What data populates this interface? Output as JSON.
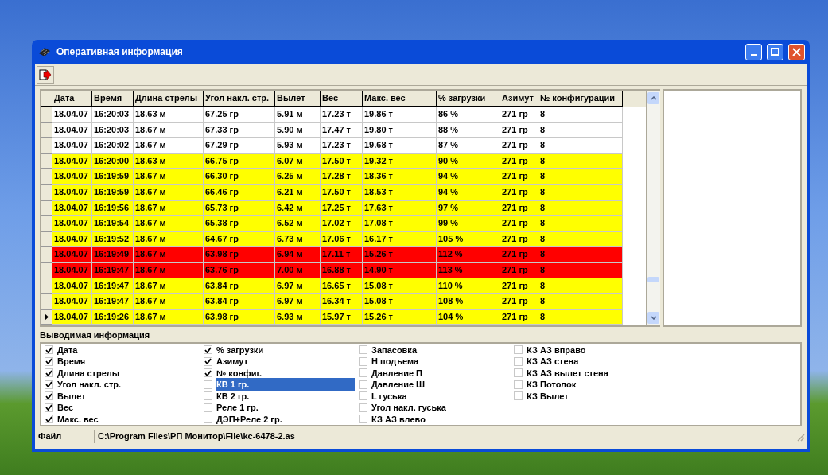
{
  "window": {
    "title": "Оперативная информация"
  },
  "table": {
    "columns": [
      "Дата",
      "Время",
      "Длина стрелы",
      "Угол накл. стр.",
      "Вылет",
      "Вес",
      "Макс. вес",
      "% загрузки",
      "Азимут",
      "№ конфигурации"
    ],
    "rows": [
      {
        "color": "#ffffff",
        "selected": false,
        "cells": [
          "18.04.07",
          "16:20:03",
          "18.63 м",
          "67.25 гр",
          "5.91 м",
          "17.23 т",
          "19.86 т",
          "86 %",
          "271 гр",
          "8"
        ]
      },
      {
        "color": "#ffffff",
        "selected": false,
        "cells": [
          "18.04.07",
          "16:20:03",
          "18.67 м",
          "67.33 гр",
          "5.90 м",
          "17.47 т",
          "19.80 т",
          "88 %",
          "271 гр",
          "8"
        ]
      },
      {
        "color": "#ffffff",
        "selected": false,
        "cells": [
          "18.04.07",
          "16:20:02",
          "18.67 м",
          "67.29 гр",
          "5.93 м",
          "17.23 т",
          "19.68 т",
          "87 %",
          "271 гр",
          "8"
        ]
      },
      {
        "color": "#ffff00",
        "selected": false,
        "cells": [
          "18.04.07",
          "16:20:00",
          "18.63 м",
          "66.75 гр",
          "6.07 м",
          "17.50 т",
          "19.32 т",
          "90 %",
          "271 гр",
          "8"
        ]
      },
      {
        "color": "#ffff00",
        "selected": false,
        "cells": [
          "18.04.07",
          "16:19:59",
          "18.67 м",
          "66.30 гр",
          "6.25 м",
          "17.28 т",
          "18.36 т",
          "94 %",
          "271 гр",
          "8"
        ]
      },
      {
        "color": "#ffff00",
        "selected": false,
        "cells": [
          "18.04.07",
          "16:19:59",
          "18.67 м",
          "66.46 гр",
          "6.21 м",
          "17.50 т",
          "18.53 т",
          "94 %",
          "271 гр",
          "8"
        ]
      },
      {
        "color": "#ffff00",
        "selected": false,
        "cells": [
          "18.04.07",
          "16:19:56",
          "18.67 м",
          "65.73 гр",
          "6.42 м",
          "17.25 т",
          "17.63 т",
          "97 %",
          "271 гр",
          "8"
        ]
      },
      {
        "color": "#ffff00",
        "selected": false,
        "cells": [
          "18.04.07",
          "16:19:54",
          "18.67 м",
          "65.38 гр",
          "6.52 м",
          "17.02 т",
          "17.08 т",
          "99 %",
          "271 гр",
          "8"
        ]
      },
      {
        "color": "#ffff00",
        "selected": false,
        "cells": [
          "18.04.07",
          "16:19:52",
          "18.67 м",
          "64.67 гр",
          "6.73 м",
          "17.06 т",
          "16.17 т",
          "105 %",
          "271 гр",
          "8"
        ]
      },
      {
        "color": "#ff0000",
        "selected": false,
        "cells": [
          "18.04.07",
          "16:19:49",
          "18.67 м",
          "63.98 гр",
          "6.94 м",
          "17.11 т",
          "15.26 т",
          "112 %",
          "271 гр",
          "8"
        ]
      },
      {
        "color": "#ff0000",
        "selected": false,
        "cells": [
          "18.04.07",
          "16:19:47",
          "18.67 м",
          "63.76 гр",
          "7.00 м",
          "16.88 т",
          "14.90 т",
          "113 %",
          "271 гр",
          "8"
        ]
      },
      {
        "color": "#ffff00",
        "selected": false,
        "cells": [
          "18.04.07",
          "16:19:47",
          "18.67 м",
          "63.84 гр",
          "6.97 м",
          "16.65 т",
          "15.08 т",
          "110 %",
          "271 гр",
          "8"
        ]
      },
      {
        "color": "#ffff00",
        "selected": false,
        "cells": [
          "18.04.07",
          "16:19:47",
          "18.67 м",
          "63.84 гр",
          "6.97 м",
          "16.34 т",
          "15.08 т",
          "108 %",
          "271 гр",
          "8"
        ]
      },
      {
        "color": "#ffff00",
        "selected": true,
        "cells": [
          "18.04.07",
          "16:19:26",
          "18.67 м",
          "63.98 гр",
          "6.93 м",
          "15.97 т",
          "15.26 т",
          "104 %",
          "271 гр",
          "8"
        ]
      }
    ]
  },
  "output_info": {
    "title": "Выводимая информация",
    "columns": [
      [
        {
          "label": "Дата",
          "checked": true,
          "selected": false
        },
        {
          "label": "Время",
          "checked": true,
          "selected": false
        },
        {
          "label": "Длина стрелы",
          "checked": true,
          "selected": false
        },
        {
          "label": "Угол накл. стр.",
          "checked": true,
          "selected": false
        },
        {
          "label": "Вылет",
          "checked": true,
          "selected": false
        },
        {
          "label": "Вес",
          "checked": true,
          "selected": false
        },
        {
          "label": "Макс. вес",
          "checked": true,
          "selected": false
        }
      ],
      [
        {
          "label": "% загрузки",
          "checked": true,
          "selected": false
        },
        {
          "label": "Азимут",
          "checked": true,
          "selected": false
        },
        {
          "label": "№ конфиг.",
          "checked": true,
          "selected": false
        },
        {
          "label": "КВ 1 гр.",
          "checked": false,
          "selected": true
        },
        {
          "label": "КВ 2 гр.",
          "checked": false,
          "selected": false
        },
        {
          "label": "Реле 1 гр.",
          "checked": false,
          "selected": false
        },
        {
          "label": "ДЭП+Реле 2 гр.",
          "checked": false,
          "selected": false
        }
      ],
      [
        {
          "label": "Запасовка",
          "checked": false,
          "selected": false
        },
        {
          "label": "Н подъема",
          "checked": false,
          "selected": false
        },
        {
          "label": "Давление П",
          "checked": false,
          "selected": false
        },
        {
          "label": "Давление Ш",
          "checked": false,
          "selected": false
        },
        {
          "label": "L гуська",
          "checked": false,
          "selected": false
        },
        {
          "label": "Угол накл. гуська",
          "checked": false,
          "selected": false
        },
        {
          "label": "КЗ АЗ влево",
          "checked": false,
          "selected": false
        }
      ],
      [
        {
          "label": "КЗ АЗ вправо",
          "checked": false,
          "selected": false
        },
        {
          "label": "КЗ АЗ стена",
          "checked": false,
          "selected": false
        },
        {
          "label": "КЗ АЗ вылет стена",
          "checked": false,
          "selected": false
        },
        {
          "label": "КЗ Потолок",
          "checked": false,
          "selected": false
        },
        {
          "label": "КЗ Вылет",
          "checked": false,
          "selected": false
        }
      ]
    ]
  },
  "status_bar": {
    "label": "Файл",
    "path": "C:\\Program Files\\РП Монитор\\File\\kc-6478-2.as"
  }
}
